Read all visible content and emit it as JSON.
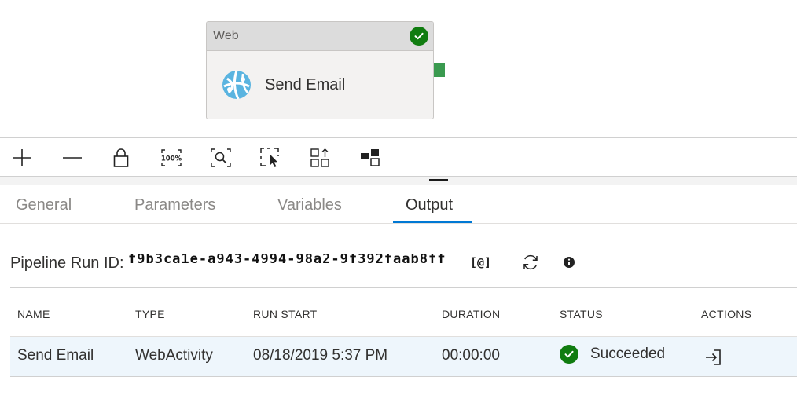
{
  "activity": {
    "type_label": "Web",
    "name": "Send Email",
    "icon": "web-activity-globe-icon",
    "status_icon": "check-circle-icon",
    "status_color": "#107c10",
    "handle_color": "#3a9a4f"
  },
  "toolbar": {
    "buttons": [
      "zoom-in-icon",
      "zoom-out-icon",
      "lock-icon",
      "zoom-100-icon",
      "zoom-to-fit-icon",
      "select-area-icon",
      "auto-align-icon",
      "show-lineage-icon"
    ],
    "zoom_100_label": "100%"
  },
  "tabs": [
    {
      "label": "General"
    },
    {
      "label": "Parameters"
    },
    {
      "label": "Variables"
    },
    {
      "label": "Output"
    }
  ],
  "active_tab": "Output",
  "accent_color": "#0078d4",
  "run": {
    "label": "Pipeline Run ID:",
    "id_value": "f9b3ca1e-a943-4994-98a2-9f392faab8ff",
    "copy_button": "[@]",
    "refresh_icon": "refresh-icon",
    "info_icon": "info-icon"
  },
  "table": {
    "columns": [
      "NAME",
      "TYPE",
      "RUN START",
      "DURATION",
      "STATUS",
      "ACTIONS"
    ],
    "rows": [
      {
        "name": "Send Email",
        "type": "WebActivity",
        "run_start": "08/18/2019 5:37 PM",
        "duration": "00:00:00",
        "status": "Succeeded",
        "action_icon": "view-output-icon"
      }
    ]
  }
}
